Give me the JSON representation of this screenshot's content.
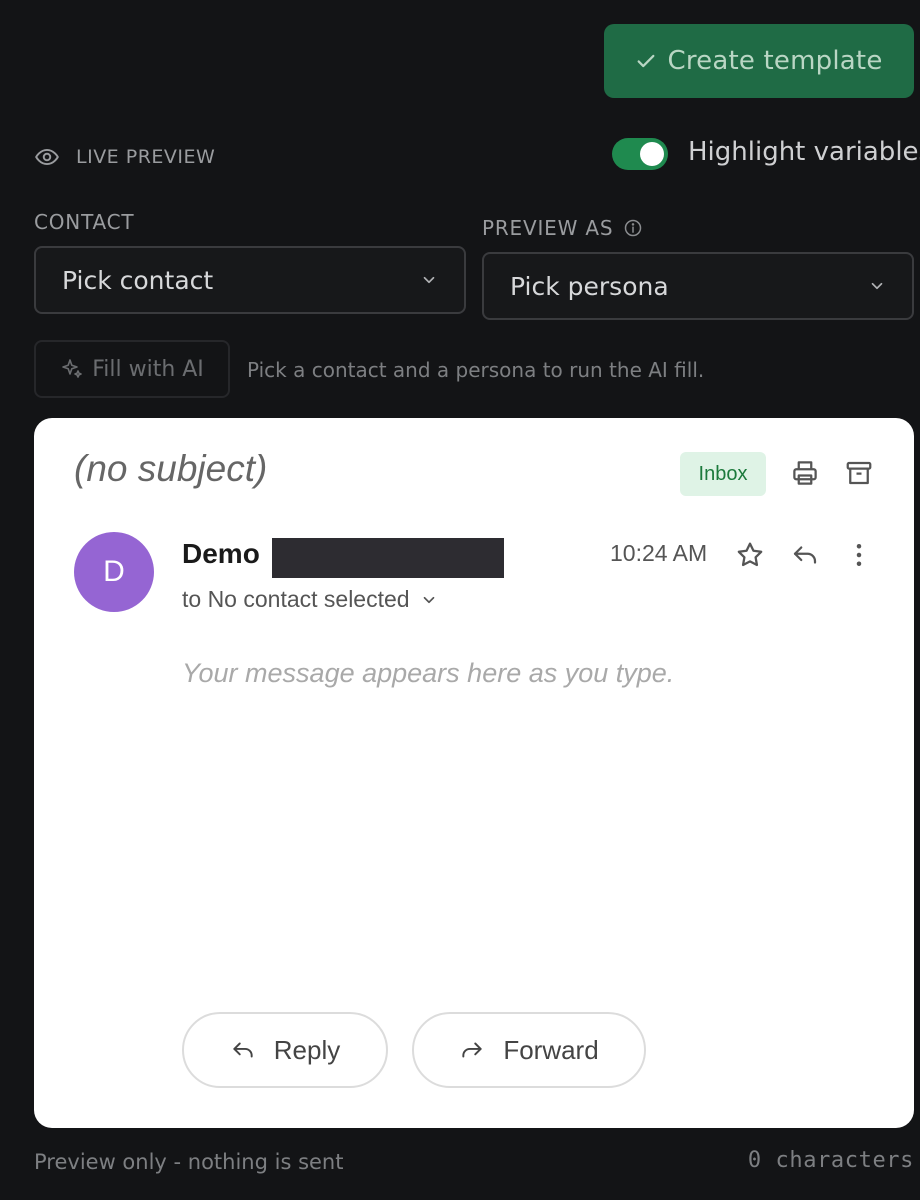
{
  "toolbar": {
    "create_label": "Create template",
    "create_icon": "check-icon"
  },
  "preview": {
    "label": "LIVE PREVIEW",
    "icon": "eye-icon",
    "highlight_label": "Highlight variables",
    "highlight_on": true
  },
  "contact": {
    "label": "CONTACT",
    "value": "Pick contact"
  },
  "persona": {
    "label": "PREVIEW AS",
    "value": "Pick persona"
  },
  "ai": {
    "fill_label": "Fill with AI",
    "hint": "Pick a contact and a persona to run the AI fill."
  },
  "email": {
    "subject": "(no subject)",
    "folder_badge": "Inbox",
    "avatar_letter": "D",
    "sender_name": "Demo",
    "time": "10:24 AM",
    "to_line": "to No contact selected",
    "body_placeholder": "Your message appears here as you type.",
    "reply_label": "Reply",
    "forward_label": "Forward"
  },
  "footer": {
    "note": "Preview only - nothing is sent",
    "char_count": "0 characters"
  },
  "colors": {
    "accent": "#1f8a4f",
    "avatar": "#9565d3",
    "badge_bg": "#dff3e6",
    "badge_text": "#1c7a3c"
  }
}
